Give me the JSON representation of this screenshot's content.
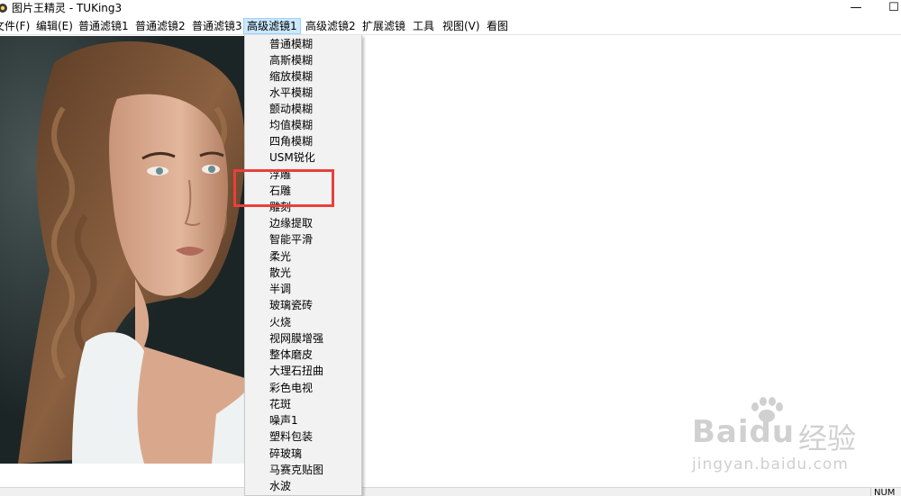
{
  "window": {
    "title": "图片王精灵 - TUKing3",
    "minimize_glyph": "—",
    "maximize_glyph": "☐"
  },
  "menubar": {
    "items": [
      {
        "label": "文件(F)",
        "active": false
      },
      {
        "label": "编辑(E)",
        "active": false
      },
      {
        "label": "普通滤镜1",
        "active": false
      },
      {
        "label": "普通滤镜2",
        "active": false
      },
      {
        "label": "普通滤镜3",
        "active": false
      },
      {
        "label": "高级滤镜1",
        "active": true
      },
      {
        "label": "高级滤镜2",
        "active": false
      },
      {
        "label": "扩展滤镜",
        "active": false
      },
      {
        "label": "工具",
        "active": false
      },
      {
        "label": "视图(V)",
        "active": false
      },
      {
        "label": "看图",
        "active": false
      }
    ]
  },
  "dropdown": {
    "items": [
      "普通模糊",
      "高斯模糊",
      "缩放模糊",
      "水平模糊",
      "颤动模糊",
      "均值模糊",
      "四角模糊",
      "USM锐化",
      "浮雕",
      "石雕",
      "雕刻",
      "边缘提取",
      "智能平滑",
      "柔光",
      "散光",
      "半调",
      "玻璃瓷砖",
      "火烧",
      "视网膜增强",
      "整体磨皮",
      "大理石扭曲",
      "彩色电视",
      "花斑",
      "噪声1",
      "塑料包装",
      "碎玻璃",
      "马赛克贴图",
      "水波"
    ],
    "highlighted": [
      "浮雕",
      "石雕"
    ]
  },
  "statusbar": {
    "indicator": "NUM"
  },
  "watermark": {
    "logo": "Bai",
    "logo_suffix": "du",
    "cn": "经验",
    "url": "jingyan.baidu.com"
  },
  "colors": {
    "highlight": "#e8403b",
    "menu_active": "#cce8ff",
    "menu_active_border": "#99d1ff",
    "dropdown_bg": "#f2f2f2"
  }
}
